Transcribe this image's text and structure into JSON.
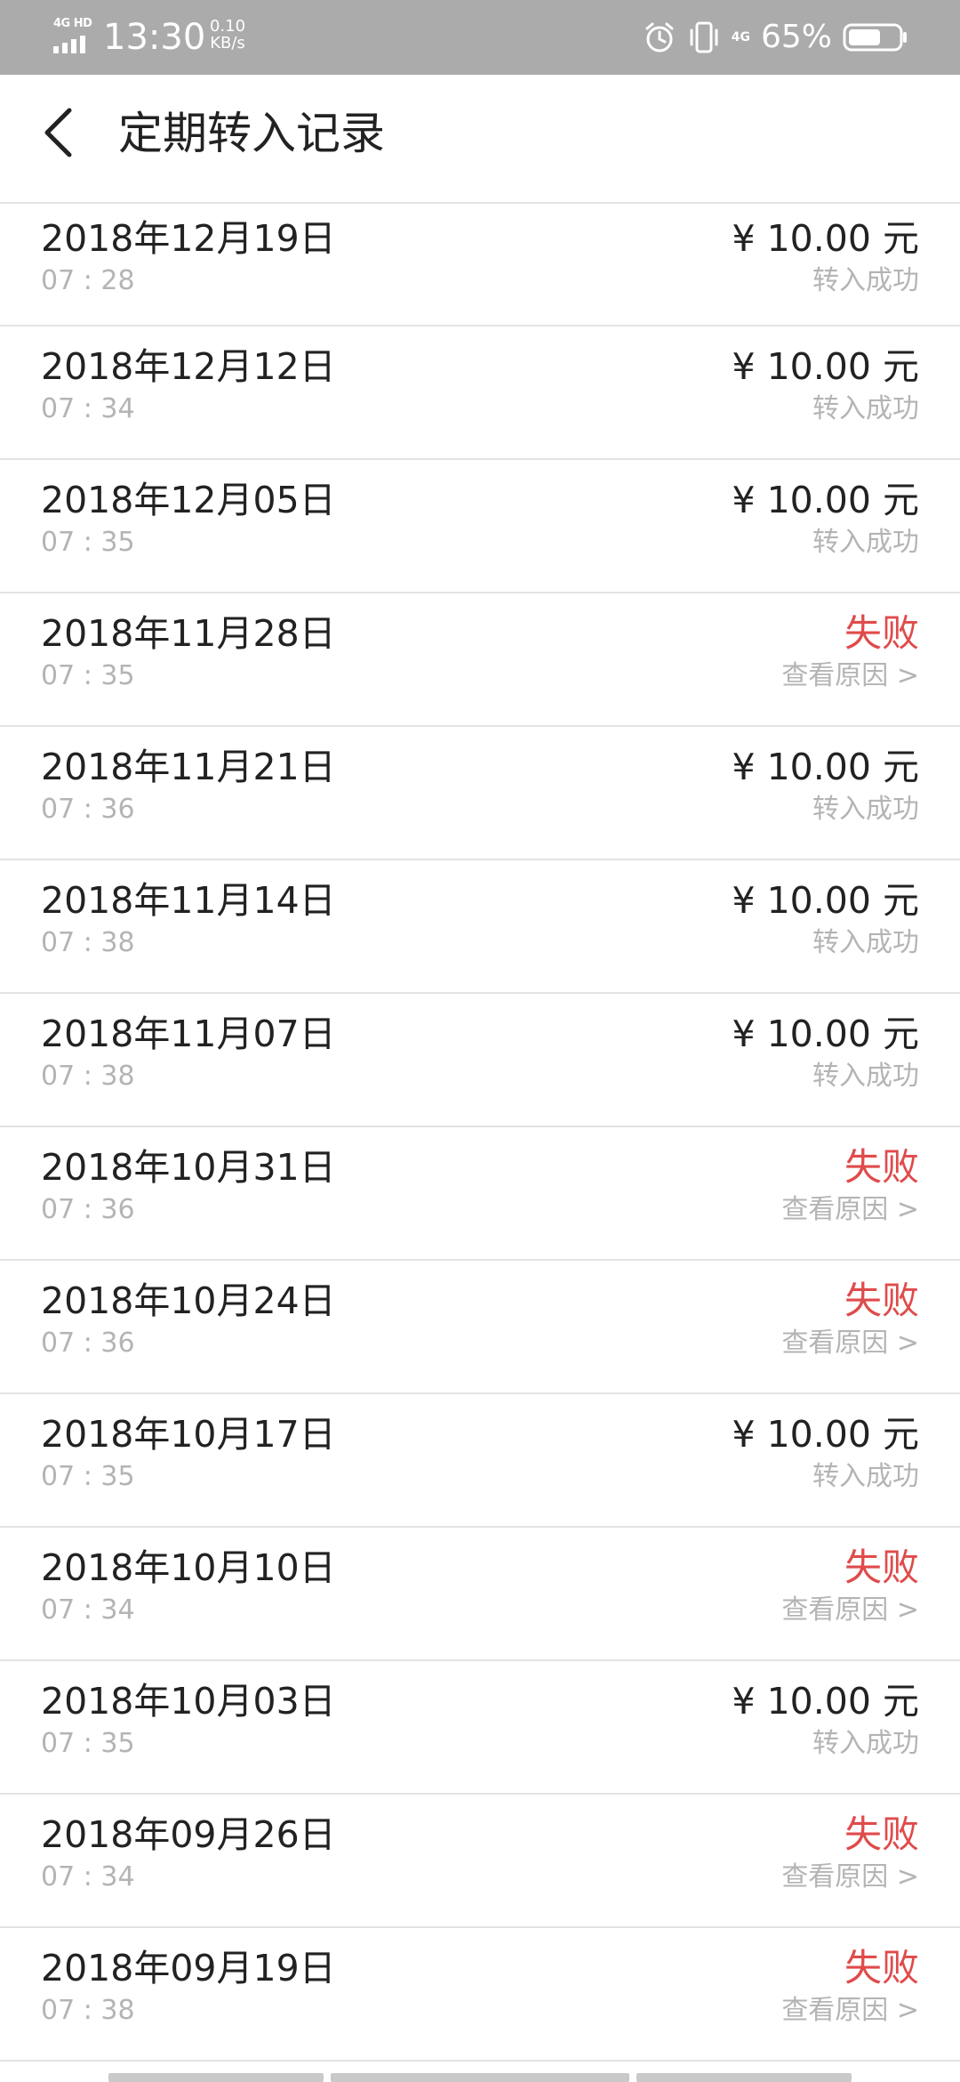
{
  "status_bar": {
    "network": "4G HD",
    "time": "13:30",
    "speed_value": "0.10",
    "speed_unit": "KB/s",
    "network_right": "4G",
    "battery_percent": "65%",
    "battery_level": 0.65,
    "icons": [
      "signal-icon",
      "alarm-icon",
      "vibrate-icon",
      "network-4g-icon",
      "battery-icon"
    ]
  },
  "header": {
    "title": "定期转入记录",
    "back_icon": "chevron-left-icon"
  },
  "colors": {
    "fail": "#e04b4b",
    "secondary_text": "#b4b4b4",
    "primary_text": "#222222",
    "status_bar_bg": "#ababab"
  },
  "records": [
    {
      "date": "2018年12月19日",
      "time": "07 : 28",
      "amount": "¥ 10.00 元",
      "status": "转入成功",
      "failed": false
    },
    {
      "date": "2018年12月12日",
      "time": "07 : 34",
      "amount": "¥ 10.00 元",
      "status": "转入成功",
      "failed": false
    },
    {
      "date": "2018年12月05日",
      "time": "07 : 35",
      "amount": "¥ 10.00 元",
      "status": "转入成功",
      "failed": false
    },
    {
      "date": "2018年11月28日",
      "time": "07 : 35",
      "amount": "失败",
      "status": "查看原因 >",
      "failed": true
    },
    {
      "date": "2018年11月21日",
      "time": "07 : 36",
      "amount": "¥ 10.00 元",
      "status": "转入成功",
      "failed": false
    },
    {
      "date": "2018年11月14日",
      "time": "07 : 38",
      "amount": "¥ 10.00 元",
      "status": "转入成功",
      "failed": false
    },
    {
      "date": "2018年11月07日",
      "time": "07 : 38",
      "amount": "¥ 10.00 元",
      "status": "转入成功",
      "failed": false
    },
    {
      "date": "2018年10月31日",
      "time": "07 : 36",
      "amount": "失败",
      "status": "查看原因 >",
      "failed": true
    },
    {
      "date": "2018年10月24日",
      "time": "07 : 36",
      "amount": "失败",
      "status": "查看原因 >",
      "failed": true
    },
    {
      "date": "2018年10月17日",
      "time": "07 : 35",
      "amount": "¥ 10.00 元",
      "status": "转入成功",
      "failed": false
    },
    {
      "date": "2018年10月10日",
      "time": "07 : 34",
      "amount": "失败",
      "status": "查看原因 >",
      "failed": true
    },
    {
      "date": "2018年10月03日",
      "time": "07 : 35",
      "amount": "¥ 10.00 元",
      "status": "转入成功",
      "failed": false
    },
    {
      "date": "2018年09月26日",
      "time": "07 : 34",
      "amount": "失败",
      "status": "查看原因 >",
      "failed": true
    },
    {
      "date": "2018年09月19日",
      "time": "07 : 38",
      "amount": "失败",
      "status": "查看原因 >",
      "failed": true
    }
  ]
}
